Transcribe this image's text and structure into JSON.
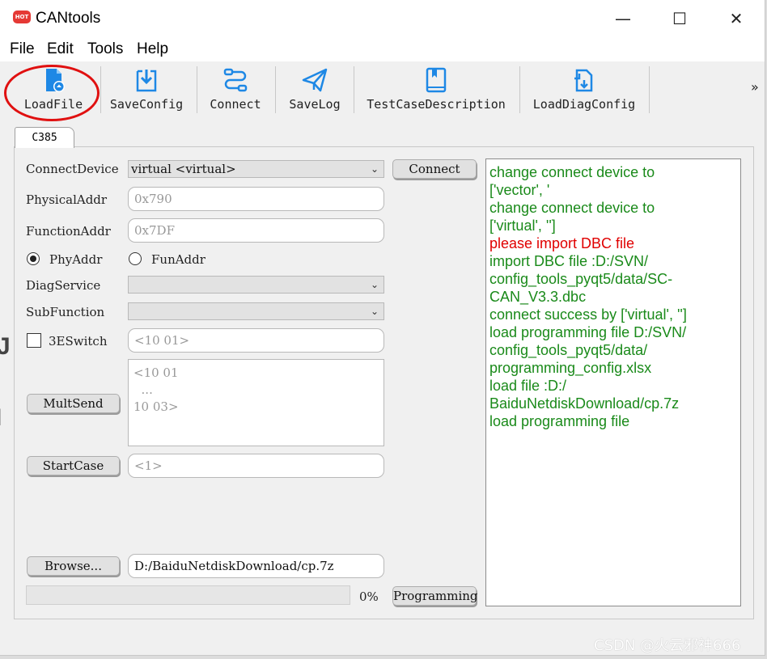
{
  "app": {
    "title": "CANtools",
    "icon_text": "HOT",
    "icon_color": "#e53935"
  },
  "window_controls": {
    "minimize": "—",
    "maximize": "☐",
    "close": "✕"
  },
  "menu": [
    "File",
    "Edit",
    "Tools",
    "Help"
  ],
  "toolbar": {
    "buttons": [
      {
        "label": "LoadFile",
        "icon": "file-upload-icon"
      },
      {
        "label": "SaveConfig",
        "icon": "save-download-icon"
      },
      {
        "label": "Connect",
        "icon": "connect-route-icon"
      },
      {
        "label": "SaveLog",
        "icon": "paper-plane-icon"
      },
      {
        "label": "TestCaseDescription",
        "icon": "book-icon"
      },
      {
        "label": "LoadDiagConfig",
        "icon": "doc-reload-icon"
      }
    ],
    "overflow": "»",
    "accent_color": "#1e88e5"
  },
  "highlight_color": "#e01010",
  "tab": {
    "label": "C385"
  },
  "form": {
    "connect_device": {
      "label": "ConnectDevice",
      "value": "virtual  <virtual>"
    },
    "connect_button": "Connect",
    "physical_addr": {
      "label": "PhysicalAddr",
      "placeholder": "0x790"
    },
    "function_addr": {
      "label": "FunctionAddr",
      "placeholder": "0x7DF"
    },
    "addr_mode": {
      "phy_label": "PhyAddr",
      "fun_label": "FunAddr",
      "selected": "PhyAddr"
    },
    "diag_service": {
      "label": "DiagService",
      "value": ""
    },
    "sub_function": {
      "label": "SubFunction",
      "value": ""
    },
    "switch_3e": {
      "label": "3ESwitch",
      "checked": false,
      "placeholder": "<10 01>"
    },
    "mult_send": {
      "button": "MultSend",
      "placeholder": "<10 01\n  ...\n10 03>"
    },
    "start_case": {
      "button": "StartCase",
      "placeholder": "<1>"
    },
    "browse": {
      "button": "Browse...",
      "value": "D:/BaiduNetdiskDownload/cp.7z"
    },
    "progress": {
      "value": 0,
      "label": "0%"
    },
    "programming_button": "Programming"
  },
  "log": [
    {
      "text": "change connect device to",
      "color": "green"
    },
    {
      "text": "['vector', '",
      "color": "green"
    },
    {
      "text": "change connect device to",
      "color": "green"
    },
    {
      "text": "['virtual', '']",
      "color": "green"
    },
    {
      "text": "please import DBC file",
      "color": "red"
    },
    {
      "text": "import DBC file :D:/SVN/",
      "color": "green"
    },
    {
      "text": "config_tools_pyqt5/data/SC-",
      "color": "green"
    },
    {
      "text": "CAN_V3.3.dbc",
      "color": "green"
    },
    {
      "text": "connect success by ['virtual', '']",
      "color": "green"
    },
    {
      "text": "load programming file D:/SVN/",
      "color": "green"
    },
    {
      "text": "config_tools_pyqt5/data/",
      "color": "green"
    },
    {
      "text": "programming_config.xlsx",
      "color": "green"
    },
    {
      "text": "load file :D:/",
      "color": "green"
    },
    {
      "text": "BaiduNetdiskDownload/cp.7z",
      "color": "green"
    },
    {
      "text": "load programming file",
      "color": "green"
    }
  ],
  "log_colors": {
    "green": "#1a8a1a",
    "red": "#e00000"
  },
  "watermark": "CSDN @火云邪神666"
}
